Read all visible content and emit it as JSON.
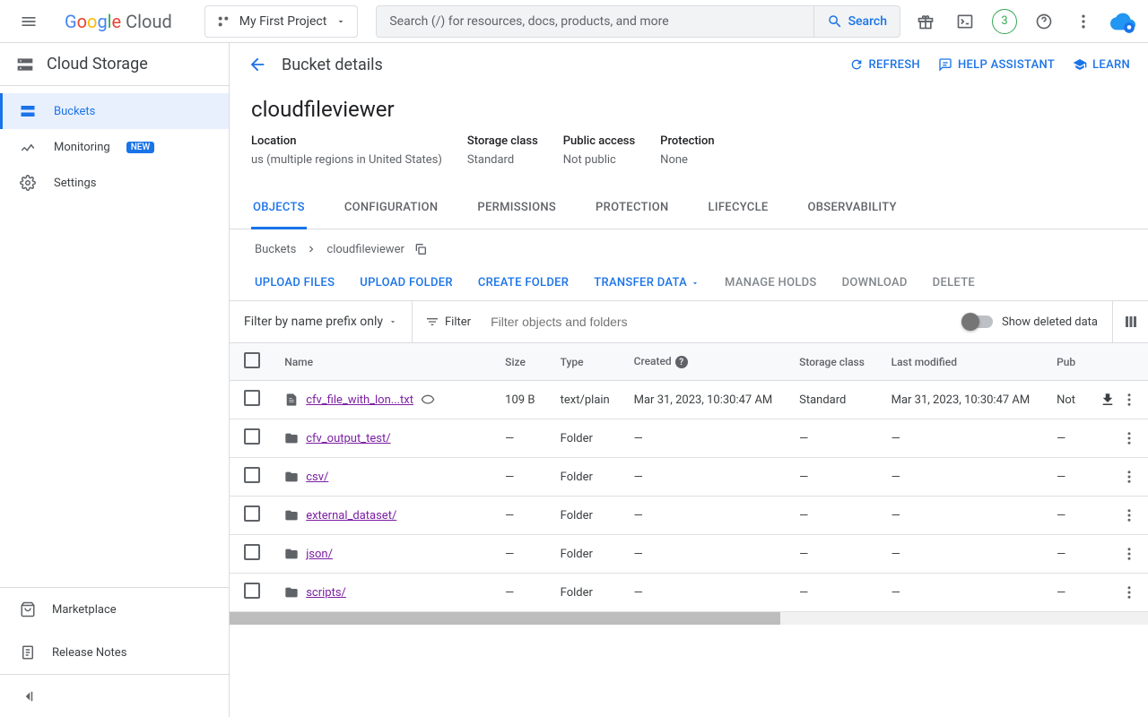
{
  "header": {
    "project_name": "My First Project",
    "search_placeholder": "Search (/) for resources, docs, products, and more",
    "search_btn": "Search",
    "trial_badge": "3"
  },
  "sidebar": {
    "product": "Cloud Storage",
    "items": [
      {
        "label": "Buckets",
        "active": true
      },
      {
        "label": "Monitoring",
        "badge": "NEW"
      },
      {
        "label": "Settings"
      }
    ],
    "footer": [
      {
        "label": "Marketplace"
      },
      {
        "label": "Release Notes"
      }
    ]
  },
  "page": {
    "title": "Bucket details",
    "actions": {
      "refresh": "REFRESH",
      "help": "HELP ASSISTANT",
      "learn": "LEARN"
    },
    "bucket_name": "cloudfileviewer",
    "info": {
      "location_label": "Location",
      "location_val": "us (multiple regions in United States)",
      "class_label": "Storage class",
      "class_val": "Standard",
      "public_label": "Public access",
      "public_val": "Not public",
      "prot_label": "Protection",
      "prot_val": "None"
    },
    "tabs": [
      "OBJECTS",
      "CONFIGURATION",
      "PERMISSIONS",
      "PROTECTION",
      "LIFECYCLE",
      "OBSERVABILITY"
    ],
    "breadcrumb": {
      "root": "Buckets",
      "current": "cloudfileviewer"
    },
    "toolbar": {
      "upload_files": "UPLOAD FILES",
      "upload_folder": "UPLOAD FOLDER",
      "create_folder": "CREATE FOLDER",
      "transfer": "TRANSFER DATA",
      "manage_holds": "MANAGE HOLDS",
      "download": "DOWNLOAD",
      "delete": "DELETE"
    },
    "filter": {
      "mode": "Filter by name prefix only",
      "label": "Filter",
      "placeholder": "Filter objects and folders",
      "show_deleted": "Show deleted data"
    },
    "columns": {
      "name": "Name",
      "size": "Size",
      "type": "Type",
      "created": "Created",
      "class": "Storage class",
      "modified": "Last modified",
      "public": "Pub"
    },
    "rows": [
      {
        "name": "cfv_file_with_lon...txt",
        "is_folder": false,
        "size": "109 B",
        "type": "text/plain",
        "created": "Mar 31, 2023, 10:30:47 AM",
        "class": "Standard",
        "modified": "Mar 31, 2023, 10:30:47 AM",
        "public": "Not",
        "has_download": true,
        "has_viz": true
      },
      {
        "name": "cfv_output_test/",
        "is_folder": true,
        "size": "—",
        "type": "Folder",
        "created": "—",
        "class": "—",
        "modified": "—",
        "public": "—"
      },
      {
        "name": "csv/",
        "is_folder": true,
        "size": "—",
        "type": "Folder",
        "created": "—",
        "class": "—",
        "modified": "—",
        "public": "—"
      },
      {
        "name": "external_dataset/",
        "is_folder": true,
        "size": "—",
        "type": "Folder",
        "created": "—",
        "class": "—",
        "modified": "—",
        "public": "—"
      },
      {
        "name": "json/",
        "is_folder": true,
        "size": "—",
        "type": "Folder",
        "created": "—",
        "class": "—",
        "modified": "—",
        "public": "—"
      },
      {
        "name": "scripts/",
        "is_folder": true,
        "size": "—",
        "type": "Folder",
        "created": "—",
        "class": "—",
        "modified": "—",
        "public": "—"
      }
    ]
  }
}
